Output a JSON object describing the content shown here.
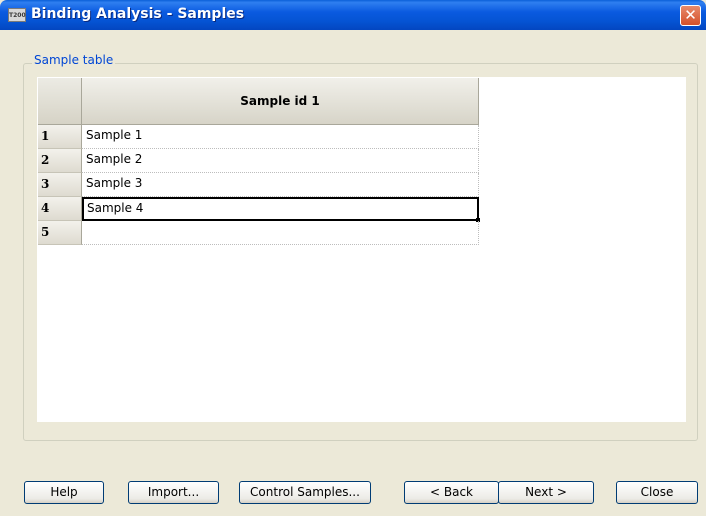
{
  "window": {
    "title": "Binding Analysis - Samples",
    "icon_text": "T200",
    "close_symbol": "✕"
  },
  "group": {
    "label": "Sample table"
  },
  "table": {
    "column_header": "Sample id 1",
    "rows": [
      {
        "number": "1",
        "value": "Sample 1"
      },
      {
        "number": "2",
        "value": "Sample 2"
      },
      {
        "number": "3",
        "value": "Sample 3"
      },
      {
        "number": "4",
        "value": "Sample 4"
      },
      {
        "number": "5",
        "value": ""
      }
    ],
    "selected_row": 4
  },
  "buttons": {
    "help": "Help",
    "import": "Import...",
    "control_samples": "Control Samples...",
    "back": "< Back",
    "next": "Next >",
    "close": "Close"
  },
  "colors": {
    "title_bar": "#0554d4",
    "group_label": "#0046d5",
    "dialog_bg": "#ece9d8"
  }
}
